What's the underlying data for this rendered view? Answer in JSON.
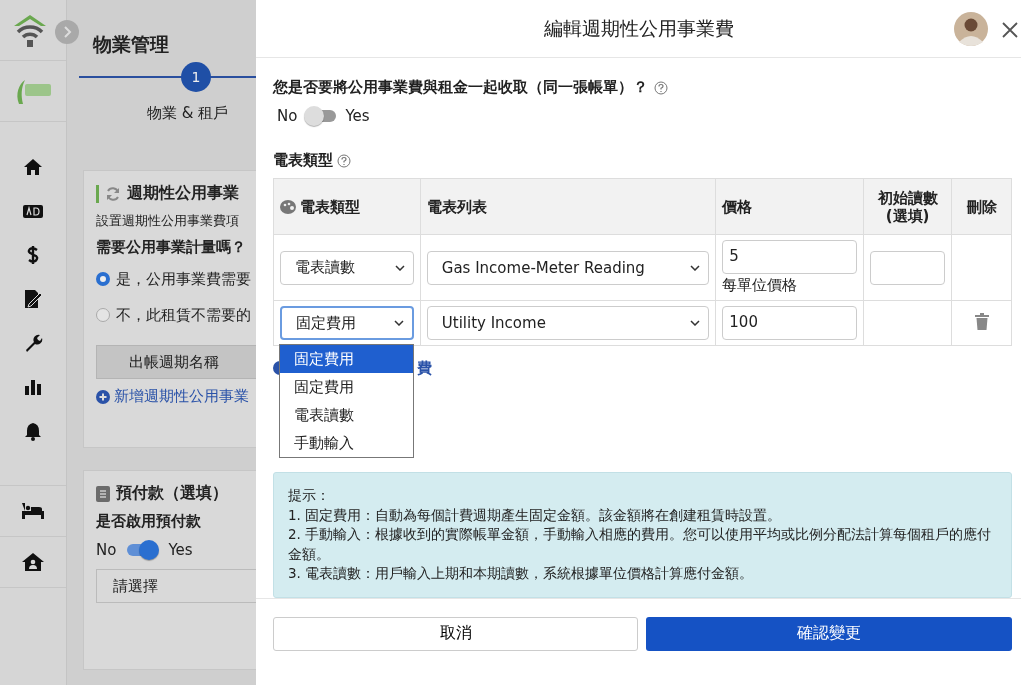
{
  "background_page": {
    "title": "物業管理",
    "step": {
      "number": "1",
      "label": "物業 & 租戶",
      "active": true
    },
    "utility_card": {
      "title": "週期性公用事業",
      "description": "設置週期性公用事業費項",
      "question": "需要公用事業計量嗎？",
      "options": [
        {
          "label": "是，公用事業費需要",
          "selected": true
        },
        {
          "label": "不，此租賃不需要的",
          "selected": false
        }
      ],
      "billing_button": "出帳週期名稱",
      "add_link": "新增週期性公用事業"
    },
    "prepay_card": {
      "title": "預付款（選填）",
      "question": "是否啟用預付款",
      "toggle": {
        "off_label": "No",
        "on_label": "Yes",
        "on": true
      },
      "select_placeholder": "請選擇"
    }
  },
  "modal": {
    "title": "編輯週期性公用事業費",
    "question": "您是否要將公用事業費與租金一起收取（同一張帳單）？",
    "toggle": {
      "off_label": "No",
      "on_label": "Yes",
      "on": false
    },
    "meter_label": "電表類型",
    "table": {
      "columns": [
        "電表類型",
        "電表列表",
        "價格",
        "初始讀數\n(選填)",
        "刪除"
      ],
      "rows": [
        {
          "type": "電表讀數",
          "list": "Gas Income-Meter Reading",
          "price": "5",
          "price_hint": "每單位價格",
          "initial_field": true,
          "deletable": false,
          "focused": false
        },
        {
          "type": "固定費用",
          "list": "Utility Income",
          "price": "100",
          "initial_field": false,
          "deletable": true,
          "focused": true
        }
      ]
    },
    "dropdown": {
      "options": [
        {
          "label": "固定費用",
          "selected": true
        },
        {
          "label": "固定費用",
          "selected": false
        },
        {
          "label": "電表讀數",
          "selected": false
        },
        {
          "label": "手動輸入",
          "selected": false
        }
      ]
    },
    "add_link": "費",
    "tip": {
      "title": "提示：",
      "lines": [
        "1. 固定費用：自動為每個計費週期產生固定金額。該金額將在創建租賃時設置。",
        "2. 手動輸入：根據收到的實際帳單金額，手動輸入相應的費用。您可以使用平均或比例分配法計算每個租戶的應付金額。",
        "3. 電表讀數：用戶輸入上期和本期讀數，系統根據單位價格計算應付金額。"
      ]
    },
    "buttons": {
      "cancel": "取消",
      "confirm": "確認變更"
    }
  }
}
